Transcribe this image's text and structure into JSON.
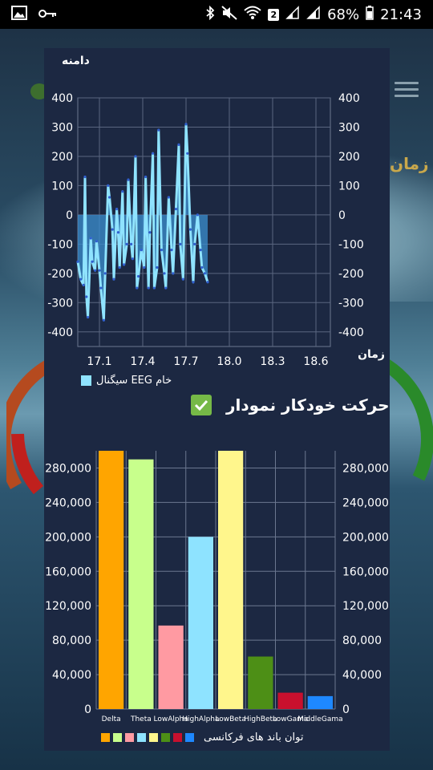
{
  "status_bar": {
    "sim": "2",
    "battery": "68%",
    "time": "21:43"
  },
  "background": {
    "label": "زمان"
  },
  "eeg_chart": {
    "title": "دامنه",
    "x_axis_label": "زمان",
    "legend_label": "سیگنال EEG خام",
    "legend_color": "#8fe3ff"
  },
  "auto_move": {
    "label": "حرکت خودکار نمودار",
    "checked": true
  },
  "band_chart": {
    "legend_label": "توان باند های فرکانسی"
  },
  "chart_data": [
    {
      "type": "line",
      "title": "",
      "ylabel": "دامنه",
      "xlabel": "زمان",
      "xlim": [
        16.95,
        18.7
      ],
      "ylim": [
        -450,
        400
      ],
      "x_ticks": [
        17.1,
        17.4,
        17.7,
        18.0,
        18.3,
        18.6
      ],
      "y_ticks": [
        -400,
        -300,
        -200,
        -100,
        0,
        100,
        200,
        300,
        400
      ],
      "series": [
        {
          "name": "سیگنال EEG خام",
          "color": "#8fe3ff",
          "x": [
            16.95,
            16.97,
            16.99,
            17.0,
            17.01,
            17.02,
            17.04,
            17.05,
            17.07,
            17.08,
            17.1,
            17.11,
            17.13,
            17.14,
            17.16,
            17.17,
            17.19,
            17.2,
            17.22,
            17.23,
            17.24,
            17.26,
            17.27,
            17.29,
            17.3,
            17.32,
            17.33,
            17.35,
            17.36,
            17.37,
            17.39,
            17.41,
            17.42,
            17.44,
            17.45,
            17.47,
            17.48,
            17.5,
            17.51,
            17.53,
            17.55,
            17.56,
            17.58,
            17.6,
            17.61,
            17.63,
            17.65,
            17.66,
            17.68,
            17.7,
            17.71,
            17.73,
            17.75,
            17.76,
            17.78,
            17.8,
            17.81,
            17.83,
            17.85
          ],
          "values": [
            -160,
            -220,
            -240,
            130,
            -280,
            -350,
            -80,
            -160,
            -190,
            -90,
            -190,
            -250,
            -360,
            -200,
            100,
            60,
            -50,
            -220,
            20,
            -60,
            -180,
            80,
            -170,
            -100,
            120,
            -100,
            -150,
            200,
            -250,
            -210,
            -120,
            -180,
            130,
            -250,
            -60,
            210,
            -250,
            -180,
            290,
            -120,
            -200,
            -250,
            60,
            -120,
            -200,
            20,
            240,
            -100,
            -220,
            310,
            210,
            -50,
            -230,
            -100,
            0,
            -120,
            -180,
            -200,
            -230
          ]
        }
      ]
    },
    {
      "type": "bar",
      "title": "",
      "categories": [
        "Delta",
        "Theta",
        "LowAlpha",
        "HighAlpha",
        "LowBeta",
        "HighBeta",
        "LowGama",
        "MiddleGama"
      ],
      "values": [
        300000,
        290000,
        97000,
        200000,
        300000,
        61000,
        19000,
        15000
      ],
      "colors": [
        "#ffa500",
        "#c8ff8c",
        "#ff9aa2",
        "#8ee3ff",
        "#fff68c",
        "#4d8f16",
        "#c8102e",
        "#1e88ff"
      ],
      "ylim": [
        0,
        300000
      ],
      "y_ticks": [
        "0",
        "40,000",
        "80,000",
        "120,000",
        "160,000",
        "200,000",
        "240,000",
        "280,000"
      ],
      "legend": "توان باند های فرکانسی"
    }
  ]
}
